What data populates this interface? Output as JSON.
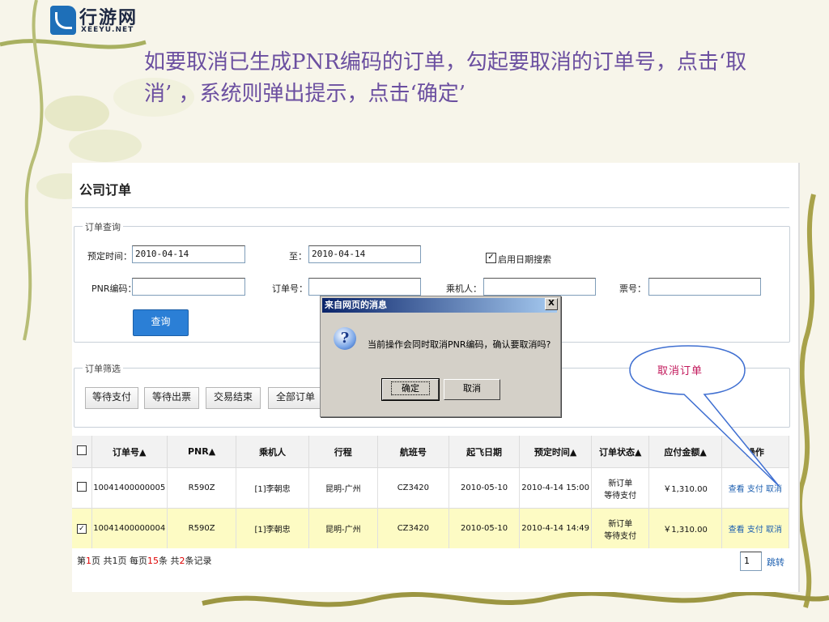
{
  "logo": {
    "cn": "行游网",
    "en": "XEEYU.NET"
  },
  "heading": "如要取消已生成PNR编码的订单，勾起要取消的订单号，点击‘取消’ ，系统则弹出提示，点击‘确定’",
  "panel": {
    "title": "公司订单",
    "query": {
      "legend": "订单查询",
      "date_from_label": "预定时间：",
      "date_from": "2010-04-14",
      "date_to_label": "至：",
      "date_to": "2010-04-14",
      "enable_date_label": "启用日期搜索",
      "enable_date_checked": "✓",
      "pnr_label": "PNR编码：",
      "pnr_value": "",
      "order_label": "订单号：",
      "order_value": "",
      "passenger_label": "乘机人：",
      "ticket_label": "票号：",
      "search_button": "查询"
    },
    "filter": {
      "legend": "订单筛选",
      "buttons": [
        "等待支付",
        "等待出票",
        "交易结束",
        "全部订单"
      ]
    }
  },
  "table": {
    "headers": [
      "订单号▲",
      "PNR▲",
      "乘机人",
      "行程",
      "航班号",
      "起飞日期",
      "预定时间▲",
      "订单状态▲",
      "应付金额▲",
      "操作"
    ],
    "rows": [
      {
        "checked": "",
        "order": "10041400000005",
        "pnr": "R590Z",
        "passenger": "[1]李朝忠",
        "route": "昆明-广州",
        "flight": "CZ3420",
        "date": "2010-05-10",
        "booked": "2010-4-14 15:00",
        "status1": "新订单",
        "status2": "等待支付",
        "amount": "￥1,310.00",
        "ops": [
          "查看",
          "支付",
          "取消"
        ]
      },
      {
        "checked": "✓",
        "order": "10041400000004",
        "pnr": "R590Z",
        "passenger": "[1]李朝忠",
        "route": "昆明-广州",
        "flight": "CZ3420",
        "date": "2010-05-10",
        "booked": "2010-4-14 14:49",
        "status1": "新订单",
        "status2": "等待支付",
        "amount": "￥1,310.00",
        "ops": [
          "查看",
          "支付",
          "取消"
        ]
      }
    ]
  },
  "pager": {
    "p1": "第",
    "page": "1",
    "p2": "页 共",
    "total_pages": "1",
    "p3": "页 每页",
    "per_page": "15",
    "p4": "条 共",
    "count": "2",
    "p5": "条记录",
    "input": "1",
    "go": "跳转"
  },
  "dialog": {
    "title": "来自网页的消息",
    "close": "X",
    "icon": "?",
    "message": "当前操作会同时取消PNR编码，确认要取消吗?",
    "ok": "确定",
    "cancel": "取消"
  },
  "callout": "取消订单",
  "colors": {
    "heading": "#6b4fa0",
    "link": "#1c5fb0",
    "highlight_row": "#fdfbc4",
    "callout_text": "#c2185b",
    "query_button": "#2b7fd6"
  }
}
